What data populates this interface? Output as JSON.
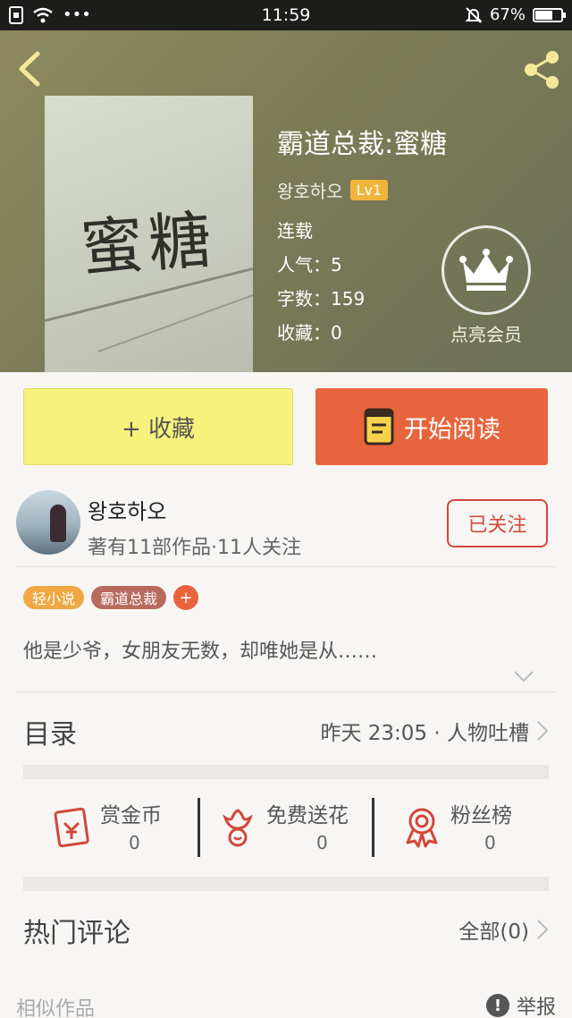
{
  "status_bar": {
    "time": "11:59",
    "battery": "67%",
    "battery_level": 0.67
  },
  "book": {
    "title": "霸道总裁:蜜糖",
    "author": "왕호하오",
    "level": "Lv1",
    "status": "连载",
    "popularity": "人气：5",
    "word_count": "字数：159",
    "favorites": "收藏：0",
    "cover_text": "蜜糖"
  },
  "vip": {
    "label": "点亮会员"
  },
  "actions": {
    "collect": "+ 收藏",
    "read": "开始阅读"
  },
  "author_card": {
    "name": "왕호하오",
    "sub": "著有11部作品·11人关注",
    "follow": "已关注"
  },
  "tags": [
    {
      "label": "轻小说",
      "color": "#f0a843"
    },
    {
      "label": "霸道总裁",
      "color": "#b86a5c"
    }
  ],
  "tag_add": "+",
  "summary": "他是少爷，女朋友无数，却唯她是从……",
  "catalog": {
    "title": "目录",
    "latest": "昨天 23:05 · 人物吐槽"
  },
  "stats": [
    {
      "label": "赏金币",
      "value": "0",
      "icon": "reward-envelope-icon"
    },
    {
      "label": "免费送花",
      "value": "0",
      "icon": "flower-icon"
    },
    {
      "label": "粉丝榜",
      "value": "0",
      "icon": "medal-icon"
    }
  ],
  "comments": {
    "title": "热门评论",
    "all": "全部(0)"
  },
  "footer": {
    "similar": "相似作品",
    "report": "举报"
  },
  "colors": {
    "accent_orange": "#e8643c",
    "accent_yellow": "#f7f27c",
    "follow_red": "#d2483a",
    "icon_red": "#d2483a"
  }
}
